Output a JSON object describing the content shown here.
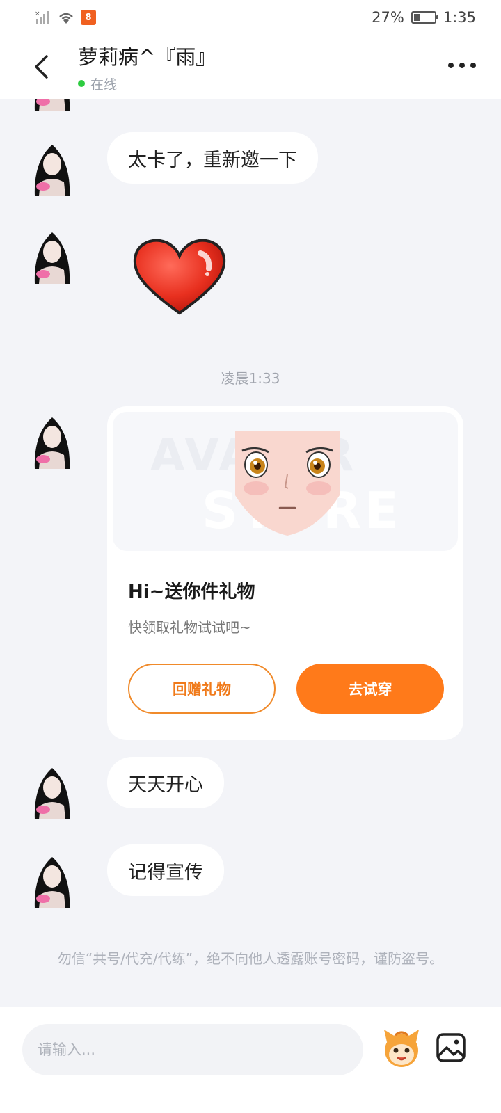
{
  "status_bar": {
    "battery": "27%",
    "time": "1:35",
    "app_badge": "8"
  },
  "header": {
    "title": "萝莉病^『雨』",
    "status": "在线"
  },
  "messages": [
    {
      "text": "太卡了，重新邀一下"
    },
    {
      "text": ""
    },
    {
      "text": "天天开心"
    },
    {
      "text": "记得宣传"
    }
  ],
  "timestamp": "凌晨1:33",
  "gift_card": {
    "banner_text_1": "AVATAR",
    "banner_text_2": "STORE",
    "title": "Hi~送你件礼物",
    "subtitle": "快领取礼物试试吧~",
    "return_gift_label": "回赠礼物",
    "try_on_label": "去试穿"
  },
  "notice": "勿信“共号/代充/代练”，绝不向他人透露账号密码，谨防盗号。",
  "input": {
    "placeholder": "请输入..."
  },
  "colors": {
    "accent": "#ff7a1a",
    "online": "#2ecc40"
  }
}
